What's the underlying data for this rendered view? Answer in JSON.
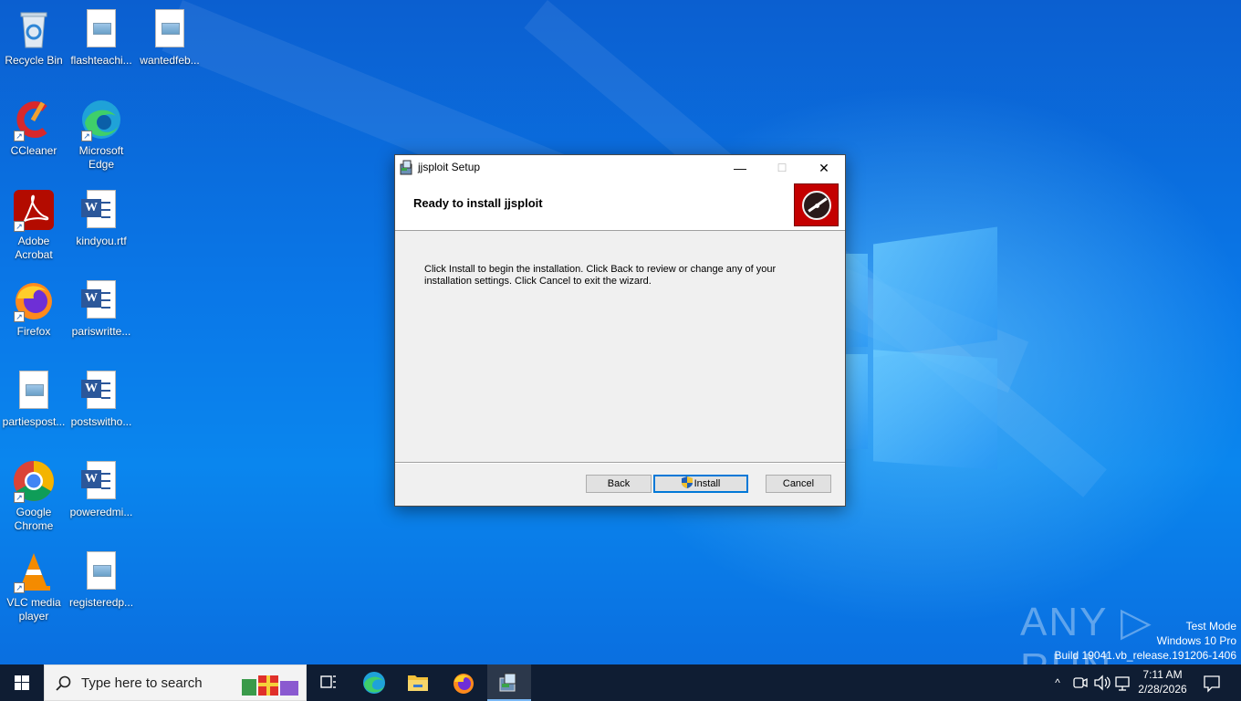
{
  "desktop": {
    "icons": [
      {
        "label": "Recycle Bin",
        "icon": "recycle-bin-icon"
      },
      {
        "label": "flashteachi...",
        "icon": "image-file-icon"
      },
      {
        "label": "wantedfeb...",
        "icon": "image-file-icon"
      },
      {
        "label": "CCleaner",
        "icon": "ccleaner-icon"
      },
      {
        "label": "Microsoft Edge",
        "icon": "edge-icon"
      },
      {
        "label": "Adobe Acrobat",
        "icon": "acrobat-icon"
      },
      {
        "label": "kindyou.rtf",
        "icon": "word-doc-icon"
      },
      {
        "label": "Firefox",
        "icon": "firefox-icon"
      },
      {
        "label": "pariswritte...",
        "icon": "word-doc-icon"
      },
      {
        "label": "partiespost...",
        "icon": "image-file-icon"
      },
      {
        "label": "postswitho...",
        "icon": "word-doc-icon"
      },
      {
        "label": "Google Chrome",
        "icon": "chrome-icon"
      },
      {
        "label": "poweredmi...",
        "icon": "word-doc-icon"
      },
      {
        "label": "VLC media player",
        "icon": "vlc-icon"
      },
      {
        "label": "registeredp...",
        "icon": "image-file-icon"
      }
    ]
  },
  "dialog": {
    "title": "jjsploit Setup",
    "heading": "Ready to install jjsploit",
    "body": "Click Install to begin the installation. Click Back to review or change any of your installation settings. Click Cancel to exit the wizard.",
    "buttons": {
      "back": "Back",
      "install": "Install",
      "cancel": "Cancel"
    },
    "caption": {
      "minimize": "—",
      "maximize": "☐",
      "close": "✕"
    }
  },
  "watermark": {
    "brand": "ANY ▷ RUN",
    "line1": "Test Mode",
    "line2": "Windows 10 Pro",
    "line3": "Build 19041.vb_release.191206-1406"
  },
  "taskbar": {
    "search_placeholder": "Type here to search",
    "time": "7:11 AM",
    "date": "2/28/2026"
  },
  "colors": {
    "accent": "#0078d7",
    "taskbar": "#0f1d33",
    "banner_red": "#c40000"
  }
}
